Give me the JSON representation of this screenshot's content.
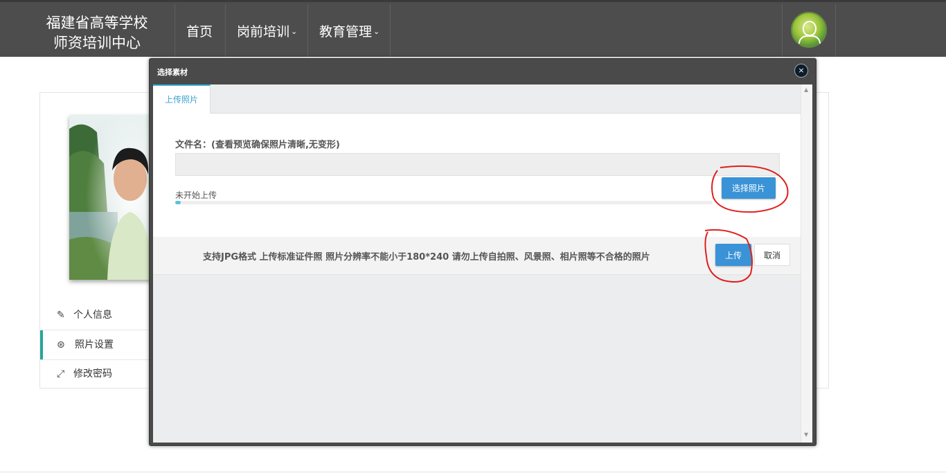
{
  "navbar": {
    "brand_line1": "福建省高等学校",
    "brand_line2": "师资培训中心",
    "items": [
      {
        "label": "首页",
        "caret": ""
      },
      {
        "label": "岗前培训",
        "caret": "⌄"
      },
      {
        "label": "教育管理",
        "caret": "⌄"
      }
    ],
    "avatar_icon": "user-avatar-icon"
  },
  "sidebar": {
    "items": [
      {
        "label": "个人信息",
        "icon": "wand-icon",
        "glyph": "✎"
      },
      {
        "label": "照片设置",
        "icon": "lifebuoy-icon",
        "glyph": "⊛"
      },
      {
        "label": "修改密码",
        "icon": "expand-icon",
        "glyph": "⤢"
      }
    ],
    "active_index": 1
  },
  "modal": {
    "title": "选择素材",
    "close_glyph": "×",
    "tab_label": "上传照片",
    "file_label": "文件名：(查看预览确保照片清晰,无变形)",
    "file_value": "",
    "status_text": "未开始上传",
    "progress": 0.01,
    "choose_button": "选择照片",
    "hint": "支持JPG格式 上传标准证件照 照片分辨率不能小于180*240 请勿上传自拍照、风景照、相片照等不合格的照片",
    "upload_button": "上传",
    "cancel_button": "取消"
  },
  "colors": {
    "navbar": "#4d4d4d",
    "accent_blue": "#3a93d6",
    "tab_accent": "#3ab0dc",
    "sidebar_active": "#26a69a",
    "annotation_red": "#e01e1e"
  }
}
